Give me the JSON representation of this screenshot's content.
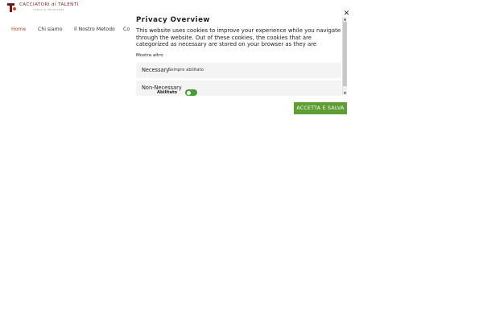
{
  "brand": {
    "name": "CACCIATORI di TALENTI",
    "tagline": "CERCA & SELEZIONE",
    "accent": "#7a1f1f"
  },
  "nav": {
    "items": [
      {
        "label": "Home",
        "active": true
      },
      {
        "label": "Chi siamo"
      },
      {
        "label": "Il Nostro Metodo"
      },
      {
        "label": "Co"
      }
    ]
  },
  "cookie_modal": {
    "title": "Privacy Overview",
    "description": "This website uses cookies to improve your experience while you navigate through the website. Out of these cookies, the cookies that are categorized as necessary are stored on your browser as they are essential for the working of basic functionalities...",
    "show_more": "Mostra altro",
    "close_icon": "close-icon",
    "categories": [
      {
        "title": "Necessary",
        "status": "Sempre abilitato"
      },
      {
        "title": "Non-Necessary",
        "toggle_label": "Abilitato",
        "enabled": true
      }
    ],
    "accept_label": "ACCETTA E SALVA",
    "accept_color": "#5e9e34",
    "toggle_color": "#4a9a3a"
  }
}
